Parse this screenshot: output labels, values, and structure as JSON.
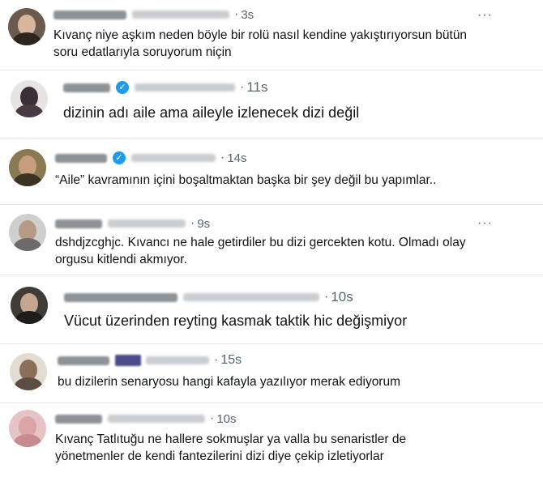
{
  "more_icon": "more-horizontal-icon",
  "verified_icon": "verified-badge-icon",
  "tweets": [
    {
      "time": "3s",
      "text": [
        "Kıvanç niye aşkım neden böyle bir rolü nasıl kendine yakıştırıyorsun bütün",
        "soru edatlarıyla soruyorum niçin"
      ]
    },
    {
      "time": "11s",
      "text": [
        "dizinin adı aile ama aileyle izlenecek dizi değil"
      ]
    },
    {
      "time": "14s",
      "text": [
        "“Aile” kavramının içini boşaltmaktan başka bir şey değil bu yapımlar.."
      ]
    },
    {
      "time": "9s",
      "text": [
        "dshdjzcghjc. Kıvancı ne hale getirdiler bu dizi gercekten kotu. Olmadı olay",
        "orgusu kitlendi akmıyor."
      ]
    },
    {
      "time": "10s",
      "text": [
        "Vücut üzerinden reyting kasmak taktik hic değişmiyor"
      ]
    },
    {
      "time": "15s",
      "text": [
        "bu dizilerin senaryosu hangi kafayla yazılıyor merak ediyorum"
      ]
    },
    {
      "time": "10s",
      "text": [
        "Kıvanç Tatlıtuğu ne hallere sokmuşlar ya valla bu senaristler de",
        "yönetmenler de kendi fantezilerini dizi diye çekip izletiyorlar"
      ]
    }
  ]
}
